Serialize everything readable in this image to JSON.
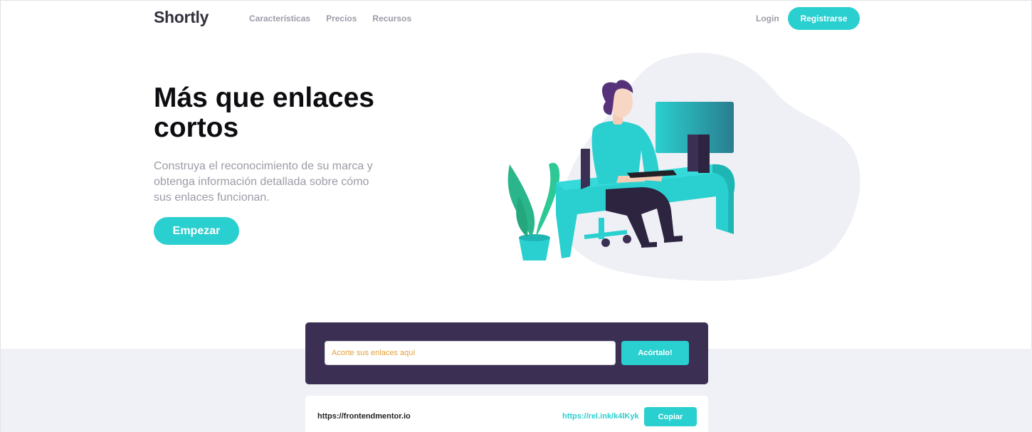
{
  "header": {
    "logo": "Shortly",
    "nav": [
      "Características",
      "Precios",
      "Recursos"
    ],
    "login": "Login",
    "signup": "Registrarse"
  },
  "hero": {
    "title": "Más que enlaces cortos",
    "subtitle": "Construya el reconocimiento de su marca y obtenga información detallada sobre cómo sus enlaces funcionan.",
    "cta": "Empezar",
    "illustration_icon": "person-working-illustration"
  },
  "shorten": {
    "placeholder": "Acorte sus enlaces aquí",
    "button": "Acórtalo!"
  },
  "results": [
    {
      "original": "https://frontendmentor.io",
      "short": "https://rel.ink/k4lKyk",
      "copy_label": "Copiar"
    }
  ],
  "colors": {
    "primary": "#2acfcf",
    "dark_violet": "#3b3054",
    "grayish_violet": "#9e9aa7",
    "background_gray": "#f0f1f6"
  }
}
